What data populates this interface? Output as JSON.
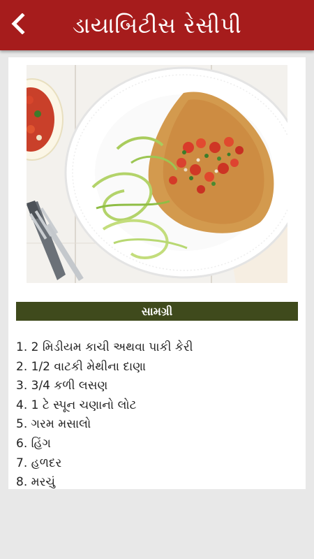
{
  "app_bar": {
    "title": "ડાયાબિટીસ રેસીપી",
    "back_icon": "chevron-left-icon",
    "color": "#a61c1c"
  },
  "recipe": {
    "image_alt": "dish-photo",
    "section_title": "સામગ્રી",
    "section_color": "#3f4a1c",
    "ingredients": [
      "1. 2 મિડીયમ કાચી અથવા પાકી કેરી",
      "2. 1/2 વાટકી મેથીના દાણા",
      "3. 3/4 કળી લસણ",
      "4. 1 ટે સ્પૂન ચણાનો લોટ",
      "5. ગરમ મસાલો",
      "6. હિંગ",
      "7. હળદર",
      "8. મરચું"
    ]
  }
}
